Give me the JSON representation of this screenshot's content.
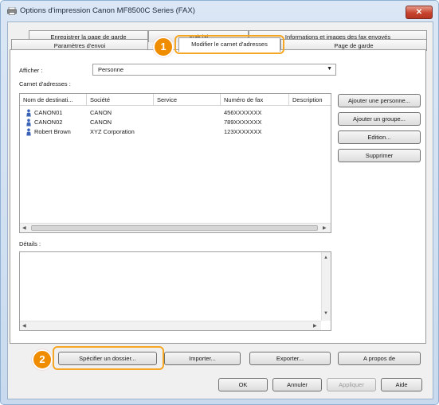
{
  "window": {
    "title": "Options d'impression Canon MF8500C Series (FAX)",
    "close_label": "✕"
  },
  "tabs": {
    "back_row": [
      {
        "label": "Enregistrer la page de garde"
      },
      {
        "label": "Spécial"
      },
      {
        "label": "Informations et images des fax envoyés"
      }
    ],
    "front_row": [
      {
        "label": "Paramètres d'envoi"
      },
      {
        "label": "Modifier le carnet d'adresses"
      },
      {
        "label": "Page de garde"
      }
    ]
  },
  "afficher": {
    "label": "Afficher :",
    "value": "Personne"
  },
  "carnet": {
    "label": "Carnet d'adresses :",
    "columns": [
      "Nom de destinati...",
      "Société",
      "Service",
      "Numéro de fax",
      "Description"
    ],
    "rows": [
      {
        "name": "CANON01",
        "company": "CANON",
        "service": "",
        "fax": "456XXXXXXX"
      },
      {
        "name": "CANON02",
        "company": "CANON",
        "service": "",
        "fax": "789XXXXXXX"
      },
      {
        "name": "Robert Brown",
        "company": "XYZ Corporation",
        "service": "",
        "fax": "123XXXXXXX"
      }
    ]
  },
  "side_buttons": {
    "add_person": "Ajouter une personne...",
    "add_group": "Ajouter un groupe...",
    "edit": "Edition...",
    "delete": "Supprimer"
  },
  "details": {
    "label": "Détails :"
  },
  "bottom_buttons": {
    "folder": "Spécifier un dossier...",
    "import": "Importer...",
    "export": "Exporter...",
    "about": "A propos de"
  },
  "dialog_buttons": {
    "ok": "OK",
    "cancel": "Annuler",
    "apply": "Appliquer",
    "help": "Aide"
  },
  "callouts": {
    "one": "1",
    "two": "2"
  },
  "colors": {
    "callout": "#f08c00",
    "highlight": "#f5a623",
    "close": "#c7442f"
  }
}
